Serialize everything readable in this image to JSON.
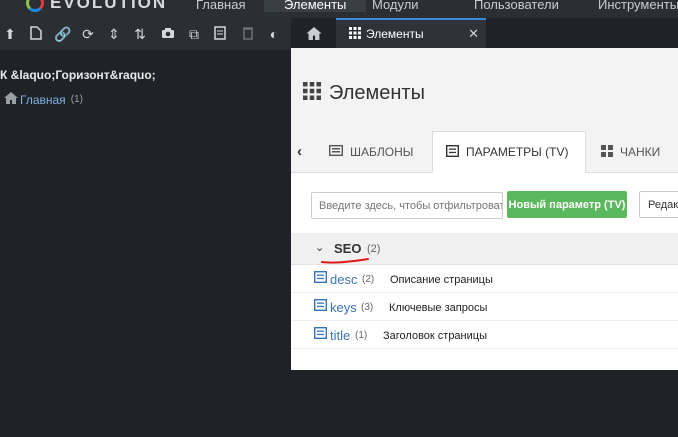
{
  "topbar": {
    "logo": "EVOLUTION",
    "nav": [
      "Главная",
      "Элементы",
      "Модули",
      "Пользователи",
      "Инструменты"
    ]
  },
  "sidebar": {
    "toolbar_icons": [
      "upload-icon",
      "new-document-icon",
      "link-icon",
      "refresh-icon",
      "sort-icon",
      "sort-order-icon",
      "camera-icon",
      "copy-icon",
      "folder-icon",
      "trash-icon",
      "contrast-icon"
    ],
    "site_name": "К &laquo;Горизонт&raquo;",
    "tree": [
      {
        "label": "Главная",
        "count": "(1)"
      }
    ]
  },
  "tabs": {
    "active_label": "Элементы",
    "close": "✕"
  },
  "main": {
    "title": "Элементы",
    "element_tabs": [
      {
        "label": "ШАБЛОНЫ"
      },
      {
        "label": "ПАРАМЕТРЫ (TV)"
      },
      {
        "label": "ЧАНКИ"
      }
    ],
    "filter_placeholder": "Введите здесь, чтобы отфильтровать",
    "new_param_label": "Новый параметр (TV)",
    "edit_label": "Редактировать",
    "category": {
      "name": "SEO",
      "count": "(2)"
    },
    "params": [
      {
        "name": "desc",
        "count": "(2)",
        "description": "Описание страницы"
      },
      {
        "name": "keys",
        "count": "(3)",
        "description": "Ключевые запросы"
      },
      {
        "name": "title",
        "count": "(1)",
        "description": "Заголовок страницы"
      }
    ]
  },
  "colors": {
    "accent": "#3a8ad8",
    "success": "#5cb85c",
    "link": "#3b74b4",
    "annotation": "#e01b1b"
  }
}
